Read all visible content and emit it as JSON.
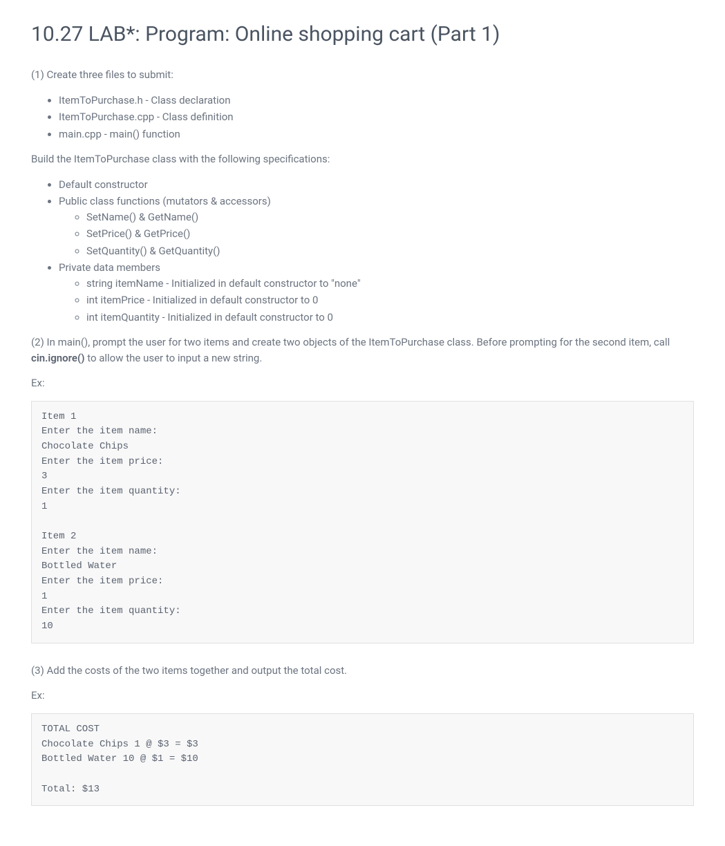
{
  "title": "10.27 LAB*: Program: Online shopping cart (Part 1)",
  "step1": {
    "intro": "(1) Create three files to submit:",
    "files": [
      "ItemToPurchase.h - Class declaration",
      "ItemToPurchase.cpp - Class definition",
      "main.cpp - main() function"
    ],
    "buildIntro": "Build the ItemToPurchase class with the following specifications:",
    "specs": {
      "item1": "Default constructor",
      "item2": "Public class functions (mutators & accessors)",
      "item2subs": [
        "SetName() & GetName()",
        "SetPrice() & GetPrice()",
        "SetQuantity() & GetQuantity()"
      ],
      "item3": "Private data members",
      "item3subs": [
        "string itemName - Initialized in default constructor to \"none\"",
        "int itemPrice - Initialized in default constructor to 0",
        "int itemQuantity - Initialized in default constructor to 0"
      ]
    }
  },
  "step2": {
    "textBefore": "(2) In main(), prompt the user for two items and create two objects of the ItemToPurchase class. Before prompting for the second item, call ",
    "code": "cin.ignore()",
    "textAfter": " to allow the user to input a new string.",
    "exLabel": "Ex:",
    "exampleOutput": "Item 1\nEnter the item name:\nChocolate Chips\nEnter the item price:\n3\nEnter the item quantity:\n1\n\nItem 2\nEnter the item name:\nBottled Water\nEnter the item price:\n1\nEnter the item quantity:\n10"
  },
  "step3": {
    "text": "(3) Add the costs of the two items together and output the total cost.",
    "exLabel": "Ex:",
    "exampleOutput": "TOTAL COST\nChocolate Chips 1 @ $3 = $3\nBottled Water 10 @ $1 = $10\n\nTotal: $13"
  }
}
